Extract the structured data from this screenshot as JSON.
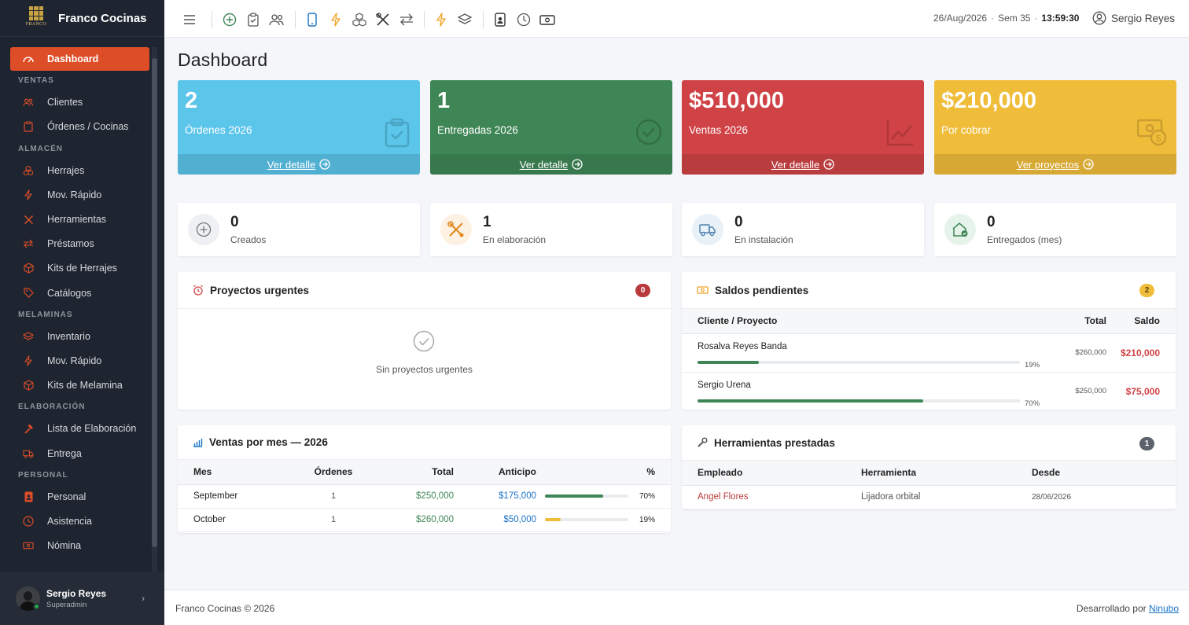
{
  "app": {
    "name": "Franco Cocinas",
    "logo_word": "FRANCO"
  },
  "sidebar": {
    "items": [
      {
        "label": "Dashboard",
        "icon": "gauge-icon",
        "active": true
      },
      {
        "section": "VENTAS"
      },
      {
        "label": "Clientes",
        "icon": "users-icon"
      },
      {
        "label": "Órdenes / Cocinas",
        "icon": "clipboard-icon"
      },
      {
        "section": "ALMACÉN"
      },
      {
        "label": "Herrajes",
        "icon": "boxes-icon"
      },
      {
        "label": "Mov. Rápido",
        "icon": "bolt-icon"
      },
      {
        "label": "Herramientas",
        "icon": "tools-icon"
      },
      {
        "label": "Préstamos",
        "icon": "exchange-icon"
      },
      {
        "label": "Kits de Herrajes",
        "icon": "box-icon"
      },
      {
        "label": "Catálogos",
        "icon": "tags-icon"
      },
      {
        "section": "MELAMINAS"
      },
      {
        "label": "Inventario",
        "icon": "layers-icon"
      },
      {
        "label": "Mov. Rápido",
        "icon": "bolt-icon"
      },
      {
        "label": "Kits de Melamina",
        "icon": "box-icon"
      },
      {
        "section": "ELABORACIÓN"
      },
      {
        "label": "Lista de Elaboración",
        "icon": "hammer-icon"
      },
      {
        "label": "Entrega",
        "icon": "truck-icon"
      },
      {
        "section": "PERSONAL"
      },
      {
        "label": "Personal",
        "icon": "id-badge-icon"
      },
      {
        "label": "Asistencia",
        "icon": "clock-icon"
      },
      {
        "label": "Nómina",
        "icon": "money-icon"
      }
    ],
    "user": {
      "name": "Sergio Reyes",
      "role": "Superadmin"
    }
  },
  "topbar": {
    "date": "26/Aug/2026",
    "week": "Sem 35",
    "time": "13:59:30",
    "user": "Sergio Reyes"
  },
  "page_title": "Dashboard",
  "stats": [
    {
      "value": "2",
      "label": "Órdenes 2026",
      "link": "Ver detalle",
      "color": "#5bc5ea"
    },
    {
      "value": "1",
      "label": "Entregadas 2026",
      "link": "Ver detalle",
      "color": "#3f8656"
    },
    {
      "value": "$510,000",
      "label": "Ventas 2026",
      "link": "Ver detalle",
      "color": "#cf4346"
    },
    {
      "value": "$210,000",
      "label": "Por cobrar",
      "link": "Ver proyectos",
      "color": "#f0bd3a"
    }
  ],
  "mini_stats": [
    {
      "value": "0",
      "label": "Creados"
    },
    {
      "value": "1",
      "label": "En elaboración"
    },
    {
      "value": "0",
      "label": "En instalación"
    },
    {
      "value": "0",
      "label": "Entregados (mes)"
    }
  ],
  "urgent": {
    "title": "Proyectos urgentes",
    "badge": "0",
    "empty_text": "Sin proyectos urgentes"
  },
  "balances": {
    "title": "Saldos pendientes",
    "badge": "2",
    "headers": [
      "Cliente / Proyecto",
      "Total",
      "Saldo"
    ],
    "rows": [
      {
        "client": "Rosalva Reyes Banda",
        "pct_label": "19%",
        "pct": 0.19,
        "total": "$260,000",
        "saldo": "$210,000"
      },
      {
        "client": "Sergio Urena",
        "pct_label": "70%",
        "pct": 0.7,
        "total": "$250,000",
        "saldo": "$75,000"
      }
    ]
  },
  "monthly": {
    "title": "Ventas por mes — 2026",
    "headers": [
      "Mes",
      "Órdenes",
      "Total",
      "Anticipo",
      "%"
    ],
    "rows": [
      {
        "month": "September",
        "orders": "1",
        "total": "$250,000",
        "advance": "$175,000",
        "pct": 0.7,
        "pct_label": "70%",
        "bar_color": "#3f8656"
      },
      {
        "month": "October",
        "orders": "1",
        "total": "$260,000",
        "advance": "$50,000",
        "pct": 0.19,
        "pct_label": "19%",
        "bar_color": "#f0bd3a"
      }
    ]
  },
  "loans": {
    "title": "Herramientas prestadas",
    "badge": "1",
    "headers": [
      "Empleado",
      "Herramienta",
      "Desde"
    ],
    "rows": [
      {
        "employee": "Angel Flores",
        "tool": "Lijadora orbital",
        "since": "28/06/2026"
      }
    ]
  },
  "footer": {
    "left": "Franco Cocinas © 2026",
    "right_prefix": "Desarrollado por",
    "right_link": "Ninubo"
  }
}
